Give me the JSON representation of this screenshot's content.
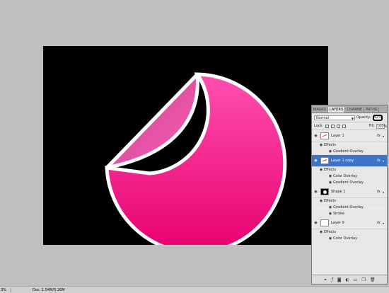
{
  "colors": {
    "workspace": "#bfbfbf",
    "canvas": "#000000",
    "sticker_pink": "#ff2d9b",
    "sticker_pink_dark": "#e8006e",
    "selected_layer": "#3e73c8"
  },
  "panel": {
    "tabs": [
      "MASKS",
      "LAYERS",
      "CHANNE",
      "PATHS"
    ],
    "blend_mode": "Normal",
    "opacity_label": "Opacity:",
    "opacity_value": "42%",
    "lock_label": "Lock:",
    "fill_label": "Fill:",
    "fill_value": "100%",
    "layers": [
      {
        "name": "Layer 1",
        "effects_label": "Effects",
        "effects": [
          "Gradient Overlay"
        ]
      },
      {
        "name": "Layer 1 copy",
        "effects_label": "Effects",
        "effects": [
          "Color Overlay",
          "Gradient Overlay"
        ]
      },
      {
        "name": "Shape 1",
        "effects_label": "Effects",
        "effects": [
          "Gradient Overlay",
          "Stroke"
        ]
      },
      {
        "name": "Layer 0",
        "effects_label": "Effects",
        "effects": [
          "Color Overlay"
        ]
      }
    ],
    "fx_glyph": "fx",
    "footer_icons": [
      "link-icon",
      "fx-icon",
      "mask-icon",
      "adjustment-icon",
      "folder-icon",
      "new-layer-icon",
      "trash-icon"
    ]
  },
  "status": {
    "zoom": "3%",
    "doc": "Doc: 1.54M/5.26M"
  }
}
